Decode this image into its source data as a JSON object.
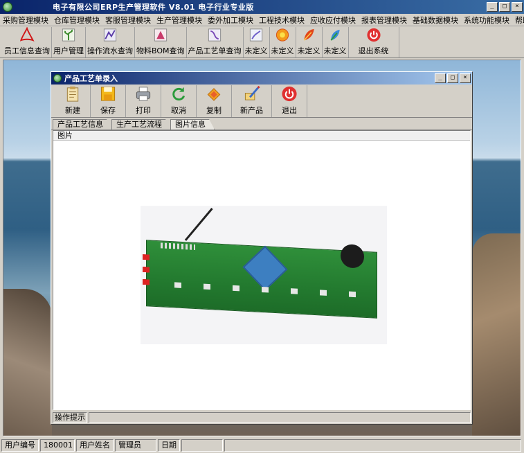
{
  "window": {
    "title": "电子有限公司ERP生产管理软件  V8.01 电子行业专业版"
  },
  "window_buttons": {
    "minimize": "_",
    "maximize": "□",
    "close": "×"
  },
  "menu": [
    "采购管理模块",
    "仓库管理模块",
    "客服管理模块",
    "生产管理模块",
    "委外加工模块",
    "工程技术模块",
    "应收应付模块",
    "报表管理模块",
    "基础数据模块",
    "系统功能模块",
    "帮助"
  ],
  "toolbar": [
    {
      "label": "员工信息查询",
      "icon": "pdf-icon"
    },
    {
      "label": "用户管理",
      "icon": "plant-icon"
    },
    {
      "label": "操作流水查询",
      "icon": "flow-icon"
    },
    {
      "label": "物料BOM查询",
      "icon": "bom-icon"
    },
    {
      "label": "产品工艺单查询",
      "icon": "process-icon"
    },
    {
      "label": "未定义",
      "icon": "undefined-icon"
    },
    {
      "label": "未定义",
      "icon": "flower-icon"
    },
    {
      "label": "未定义",
      "icon": "leaf-icon"
    },
    {
      "label": "未定义",
      "icon": "feather-icon"
    },
    {
      "label": "退出系统",
      "icon": "power-icon"
    }
  ],
  "child_window": {
    "title": "产品工艺单录入",
    "toolbar": [
      {
        "label": "新建",
        "icon": "clipboard-icon"
      },
      {
        "label": "保存",
        "icon": "floppy-icon"
      },
      {
        "label": "打印",
        "icon": "printer-icon"
      },
      {
        "label": "取消",
        "icon": "refresh-icon"
      },
      {
        "label": "复制",
        "icon": "copy-icon"
      },
      {
        "label": "新产品",
        "icon": "new-product-icon"
      },
      {
        "label": "退出",
        "icon": "power-icon"
      }
    ],
    "tabs": [
      "产品工艺信息",
      "生产工艺流程",
      "图片信息"
    ],
    "active_tab": "图片信息",
    "panel_header": "图片",
    "hint_label": "操作提示"
  },
  "statusbar": {
    "user_id_label": "用户编号",
    "user_id": "180001",
    "user_name_label": "用户姓名",
    "user_name": "管理员",
    "date_label": "日期"
  },
  "colors": {
    "titlebar": "#0a246a",
    "face": "#d4d0c8",
    "pcb": "#2f8f3a"
  }
}
